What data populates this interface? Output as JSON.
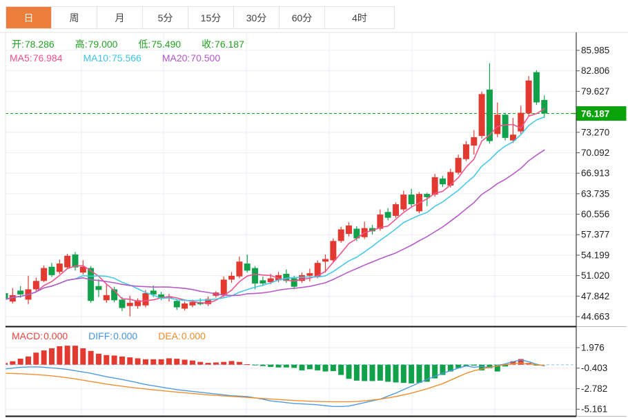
{
  "tabs": {
    "items": [
      {
        "label": "日",
        "active": true
      },
      {
        "label": "周",
        "active": false
      },
      {
        "label": "月",
        "active": false
      },
      {
        "label": "5分",
        "active": false
      },
      {
        "label": "15分",
        "active": false
      },
      {
        "label": "30分",
        "active": false
      },
      {
        "label": "60分",
        "active": false
      },
      {
        "label": "4时",
        "active": false
      }
    ]
  },
  "legend": {
    "ohlc": [
      {
        "label": "开:",
        "value": "78.286"
      },
      {
        "label": "高:",
        "value": "79.000"
      },
      {
        "label": "低:",
        "value": "75.490"
      },
      {
        "label": "收:",
        "value": "76.187"
      }
    ],
    "ma": [
      {
        "label": "MA5:",
        "value": "76.984",
        "color": "#ef4f88"
      },
      {
        "label": "MA10:",
        "value": "75.566",
        "color": "#3fc1e8"
      },
      {
        "label": "MA20:",
        "value": "70.500",
        "color": "#b354c8"
      }
    ],
    "macd": [
      {
        "label": "MACD:",
        "value": "0.000",
        "color": "#e8453c"
      },
      {
        "label": "DIFF:",
        "value": "0.000",
        "color": "#4493e0"
      },
      {
        "label": "DEA:",
        "value": "0.000",
        "color": "#f08a28"
      }
    ]
  },
  "price_tag": "76.187",
  "colors": {
    "up": "#e23a30",
    "down": "#12a14b",
    "ma5": "#f0538c",
    "ma10": "#45c8e8",
    "ma20": "#b55bc8",
    "diff": "#4e9ae0",
    "dea": "#f08e2e",
    "tab_active": "#ee7e3c",
    "text_green": "#21a21f",
    "price_tag_bg": "#0ba30b",
    "current_line": "#18a018",
    "grid": "#e9eef5",
    "zero_dash": "#b2d6ec",
    "axis_text": "#222222"
  },
  "chart_data": [
    {
      "type": "candlestick",
      "title": "",
      "legend_position": "top-left",
      "grid": true,
      "y_axis_labels": [
        "85.985",
        "82.806",
        "79.627",
        "73.270",
        "70.092",
        "66.913",
        "63.735",
        "60.556",
        "57.377",
        "54.199",
        "51.020",
        "47.842",
        "44.663"
      ],
      "ylim": [
        43.16,
        88.66
      ],
      "current_price": 76.187,
      "ma_periods": [
        5,
        10,
        20
      ],
      "candles_ohlc": [
        [
          48.3,
          48.6,
          47.0,
          47.3
        ],
        [
          47.0,
          49.1,
          46.7,
          48.0
        ],
        [
          48.7,
          49.4,
          47.6,
          48.1
        ],
        [
          47.3,
          51.0,
          46.6,
          48.9
        ],
        [
          48.9,
          50.7,
          48.5,
          50.2
        ],
        [
          50.2,
          52.6,
          50.0,
          52.2
        ],
        [
          52.4,
          53.0,
          50.8,
          51.1
        ],
        [
          51.6,
          53.5,
          51.3,
          52.9
        ],
        [
          52.3,
          54.4,
          52.0,
          54.1
        ],
        [
          54.3,
          54.7,
          51.8,
          52.3
        ],
        [
          51.5,
          53.4,
          51.2,
          52.4
        ],
        [
          52.2,
          52.5,
          46.8,
          47.1
        ],
        [
          49.4,
          50.5,
          47.7,
          48.8
        ],
        [
          47.2,
          49.7,
          46.8,
          48.0
        ],
        [
          48.9,
          49.3,
          46.9,
          47.2
        ],
        [
          47.3,
          47.7,
          45.5,
          46.0
        ],
        [
          46.3,
          47.9,
          44.7,
          46.8
        ],
        [
          46.3,
          47.5,
          45.9,
          47.2
        ],
        [
          46.4,
          48.8,
          46.1,
          48.3
        ],
        [
          48.7,
          49.5,
          47.7,
          48.1
        ],
        [
          48.1,
          48.5,
          47.2,
          47.5
        ],
        [
          47.5,
          48.2,
          47.0,
          47.8
        ],
        [
          47.1,
          47.4,
          45.7,
          46.1
        ],
        [
          45.9,
          47.0,
          45.6,
          46.7
        ],
        [
          46.4,
          47.3,
          46.1,
          46.9
        ],
        [
          46.9,
          47.5,
          46.4,
          46.6
        ],
        [
          46.6,
          47.8,
          46.3,
          47.4
        ],
        [
          47.9,
          48.6,
          47.6,
          48.4
        ],
        [
          48.0,
          50.9,
          47.7,
          50.4
        ],
        [
          50.4,
          51.6,
          49.9,
          51.0
        ],
        [
          50.9,
          54.0,
          50.6,
          53.2
        ],
        [
          52.9,
          54.3,
          51.5,
          51.8
        ],
        [
          52.2,
          52.5,
          48.9,
          49.8
        ],
        [
          50.3,
          50.9,
          49.4,
          49.8
        ],
        [
          50.0,
          51.3,
          49.7,
          50.6
        ],
        [
          50.3,
          51.6,
          50.0,
          51.1
        ],
        [
          51.3,
          52.0,
          49.9,
          50.2
        ],
        [
          50.6,
          51.0,
          48.9,
          49.3
        ],
        [
          50.2,
          51.5,
          49.9,
          51.1
        ],
        [
          51.0,
          52.1,
          50.1,
          51.4
        ],
        [
          50.9,
          53.4,
          50.6,
          53.0
        ],
        [
          53.2,
          54.3,
          51.5,
          53.6
        ],
        [
          53.4,
          56.8,
          53.1,
          56.4
        ],
        [
          56.4,
          58.6,
          56.1,
          58.2
        ],
        [
          57.5,
          59.3,
          57.1,
          58.8
        ],
        [
          58.3,
          58.7,
          56.4,
          56.8
        ],
        [
          57.0,
          59.4,
          56.7,
          58.4
        ],
        [
          58.4,
          58.9,
          57.4,
          57.9
        ],
        [
          58.3,
          61.3,
          58.0,
          60.5
        ],
        [
          60.9,
          61.5,
          59.6,
          60.0
        ],
        [
          60.3,
          62.4,
          60.0,
          62.1
        ],
        [
          61.3,
          64.2,
          61.0,
          63.6
        ],
        [
          63.6,
          64.5,
          61.6,
          62.1
        ],
        [
          61.0,
          64.0,
          60.7,
          63.7
        ],
        [
          63.7,
          63.9,
          61.8,
          63.2
        ],
        [
          63.6,
          66.8,
          63.3,
          66.3
        ],
        [
          66.1,
          66.5,
          64.8,
          65.2
        ],
        [
          65.0,
          67.6,
          64.7,
          67.1
        ],
        [
          67.0,
          69.8,
          66.7,
          69.3
        ],
        [
          69.1,
          71.9,
          68.8,
          71.4
        ],
        [
          71.2,
          73.6,
          69.8,
          72.5
        ],
        [
          72.7,
          79.6,
          72.3,
          79.2
        ],
        [
          79.9,
          84.0,
          71.5,
          71.9
        ],
        [
          73.0,
          77.9,
          72.5,
          76.0
        ],
        [
          76.0,
          76.3,
          72.0,
          72.4
        ],
        [
          72.0,
          75.5,
          71.6,
          72.9
        ],
        [
          73.4,
          77.4,
          73.0,
          76.3
        ],
        [
          76.2,
          82.0,
          75.8,
          81.3
        ],
        [
          82.6,
          82.9,
          77.5,
          77.9
        ],
        [
          78.286,
          79.0,
          75.49,
          76.187
        ]
      ]
    },
    {
      "type": "macd",
      "y_axis_labels": [
        "1.976",
        "-0.403",
        "-2.782",
        "-5.161"
      ],
      "histogram": [
        0.2,
        0.4,
        0.7,
        0.95,
        1.4,
        1.65,
        1.9,
        2.14,
        2.2,
        2.2,
        1.9,
        1.6,
        1.27,
        1.11,
        1.06,
        0.95,
        0.85,
        0.74,
        0.63,
        0.63,
        0.63,
        0.74,
        0.69,
        0.58,
        0.48,
        0.32,
        0.21,
        0.26,
        0.32,
        0.42,
        0.32,
        0.05,
        -0.05,
        -0.16,
        -0.26,
        -0.32,
        -0.32,
        -0.37,
        -0.66,
        -0.53,
        -0.66,
        -0.79,
        -0.74,
        -1.19,
        -1.64,
        -1.85,
        -1.9,
        -1.9,
        -1.85,
        -1.98,
        -2.06,
        -2.11,
        -2.17,
        -2.11,
        -1.98,
        -1.59,
        -1.19,
        -0.79,
        -0.4,
        -0.21,
        -0.11,
        -0.66,
        -0.4,
        -0.79,
        -0.21,
        0.4,
        0.66,
        0.21,
        -0.1,
        0.0
      ],
      "diff": [
        -0.5,
        -0.4,
        -0.3,
        -0.27,
        -0.25,
        -0.3,
        -0.38,
        -0.45,
        -0.55,
        -0.7,
        -0.85,
        -1.0,
        -1.2,
        -1.4,
        -1.55,
        -1.72,
        -1.9,
        -2.1,
        -2.3,
        -2.45,
        -2.6,
        -2.75,
        -2.9,
        -3.0,
        -3.1,
        -3.2,
        -3.3,
        -3.4,
        -3.5,
        -3.6,
        -3.65,
        -3.7,
        -3.85,
        -4.0,
        -4.2,
        -4.3,
        -4.4,
        -4.5,
        -4.55,
        -4.6,
        -4.65,
        -4.75,
        -4.85,
        -4.85,
        -4.8,
        -4.6,
        -4.4,
        -4.2,
        -4.0,
        -3.65,
        -3.3,
        -2.9,
        -2.5,
        -2.1,
        -1.7,
        -1.35,
        -1.0,
        -0.7,
        -0.4,
        -0.15,
        -0.3,
        -0.2,
        -0.35,
        -0.1,
        0.1,
        0.35,
        0.55,
        0.35,
        0.05,
        -0.15
      ],
      "dea": [
        -1.0,
        -1.02,
        -1.05,
        -1.1,
        -1.15,
        -1.22,
        -1.3,
        -1.4,
        -1.52,
        -1.65,
        -1.8,
        -1.95,
        -2.1,
        -2.25,
        -2.38,
        -2.5,
        -2.62,
        -2.72,
        -2.82,
        -2.92,
        -3.0,
        -3.1,
        -3.18,
        -3.26,
        -3.34,
        -3.42,
        -3.5,
        -3.56,
        -3.62,
        -3.68,
        -3.74,
        -3.8,
        -3.86,
        -3.92,
        -3.98,
        -4.04,
        -4.1,
        -4.15,
        -4.2,
        -4.24,
        -4.27,
        -4.29,
        -4.3,
        -4.3,
        -4.3,
        -4.28,
        -4.2,
        -4.1,
        -4.0,
        -3.85,
        -3.7,
        -3.5,
        -3.3,
        -3.05,
        -2.8,
        -2.5,
        -2.2,
        -1.8,
        -1.4,
        -1.0,
        -0.7,
        -0.5,
        -0.3,
        -0.15,
        0.0,
        0.1,
        0.2,
        0.1,
        0.0,
        -0.1
      ]
    }
  ]
}
